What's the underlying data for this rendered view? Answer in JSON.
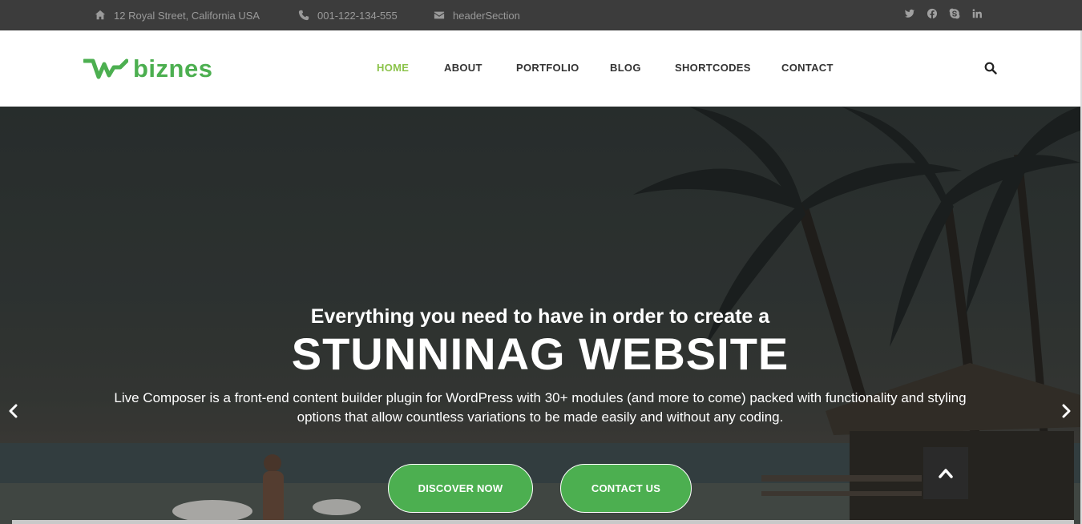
{
  "topbar": {
    "address": "12 Royal Street, California USA",
    "phone": "001-122-134-555",
    "email": "headerSection",
    "icons": {
      "address": "home-icon",
      "phone": "phone-icon",
      "email": "envelope-icon"
    },
    "social": [
      "twitter-icon",
      "facebook-icon",
      "skype-icon",
      "linkedin-icon"
    ]
  },
  "header": {
    "logo_text": "biznes",
    "nav": [
      {
        "label": "HOME",
        "active": true
      },
      {
        "label": "ABOUT",
        "active": false
      },
      {
        "label": "PORTFOLIO",
        "active": false
      },
      {
        "label": "BLOG",
        "active": false
      },
      {
        "label": "SHORTCODES",
        "active": false
      },
      {
        "label": "CONTACT",
        "active": false
      }
    ],
    "search_icon": "search-icon"
  },
  "hero": {
    "subtitle": "Everything you need to have in order to create a",
    "title": "STUNNINAG WEBSITE",
    "description": "Live Composer is a front-end content builder plugin for WordPress with 30+ modules (and more to come) packed with functionality and styling options that allow countless variations to be made easily and without any coding.",
    "buttons": {
      "discover": "DISCOVER NOW",
      "contact": "CONTACT US"
    },
    "arrows": {
      "prev": "chevron-left-icon",
      "next": "chevron-right-icon"
    },
    "back_to_top": "chevron-up-icon"
  },
  "colors": {
    "brand": "#4caf50",
    "nav_active": "#8bc34a",
    "topbar_bg": "#3c3c3c",
    "nav_text": "#333333"
  }
}
